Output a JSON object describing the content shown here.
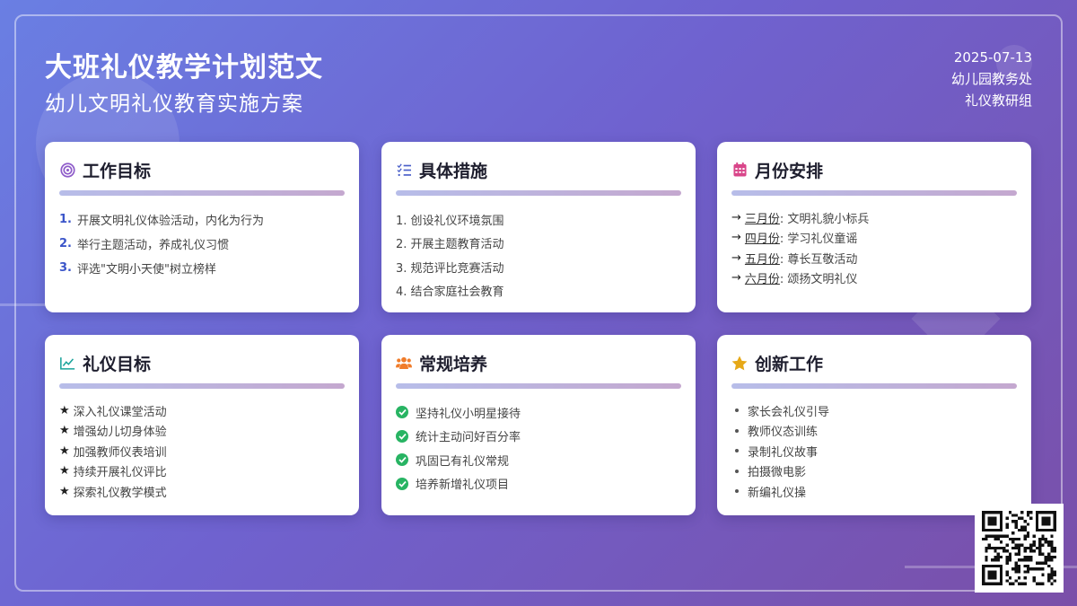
{
  "header": {
    "title": "大班礼仪教学计划范文",
    "subtitle": "幼儿文明礼仪教育实施方案",
    "date": "2025-07-13",
    "org": "幼儿园教务处",
    "group": "礼仪教研组"
  },
  "cards": {
    "work_goals": {
      "title": "工作目标",
      "icon": "target-icon",
      "items": [
        {
          "num": "1.",
          "text": "开展文明礼仪体验活动，内化为行为"
        },
        {
          "num": "2.",
          "text": "举行主题活动，养成礼仪习惯"
        },
        {
          "num": "3.",
          "text": "评选\"文明小天使\"树立榜样"
        }
      ]
    },
    "measures": {
      "title": "具体措施",
      "icon": "checklist-icon",
      "items": [
        "1. 创设礼仪环境氛围",
        "2. 开展主题教育活动",
        "3. 规范评比竞赛活动",
        "4. 结合家庭社会教育"
      ]
    },
    "monthly": {
      "title": "月份安排",
      "icon": "calendar-icon",
      "arrow": "→",
      "items": [
        {
          "month": "三月份",
          "text": ": 文明礼貌小标兵"
        },
        {
          "month": "四月份",
          "text": ": 学习礼仪童谣"
        },
        {
          "month": "五月份",
          "text": ": 尊长互敬活动"
        },
        {
          "month": "六月份",
          "text": ": 颂扬文明礼仪"
        }
      ]
    },
    "etiquette_goals": {
      "title": "礼仪目标",
      "icon": "line-chart-icon",
      "star": "★",
      "items": [
        "深入礼仪课堂活动",
        "增强幼儿切身体验",
        "加强教师仪表培训",
        "持续开展礼仪评比",
        "探索礼仪教学模式"
      ]
    },
    "routine": {
      "title": "常规培养",
      "icon": "users-icon",
      "items": [
        "坚持礼仪小明星接待",
        "统计主动问好百分率",
        "巩固已有礼仪常规",
        "培养新增礼仪项目"
      ]
    },
    "innovation": {
      "title": "创新工作",
      "icon": "star-icon",
      "items": [
        "家长会礼仪引导",
        "教师仪态训练",
        "录制礼仪故事",
        "拍摄微电影",
        "新编礼仪操"
      ]
    }
  },
  "colors": {
    "accent_blue": "#3b55c9",
    "check_green": "#28b463",
    "star_gold": "#e6a817",
    "calendar_pink": "#d9468a",
    "users_orange": "#f07c2a",
    "chart_teal": "#1aa39a"
  }
}
